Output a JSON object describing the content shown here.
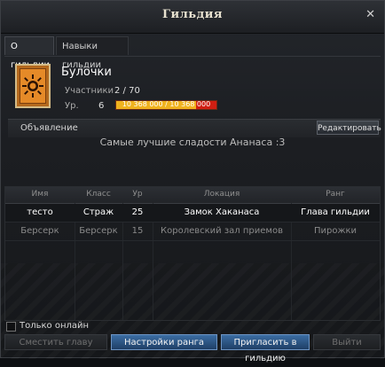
{
  "window": {
    "title": "Гильдия",
    "close_glyph": "✕"
  },
  "tabs": [
    {
      "label": "О гильдии",
      "active": true
    },
    {
      "label": "Навыки гильдии",
      "active": false
    }
  ],
  "guild": {
    "emblem_icon": "sun-emblem-icon",
    "name": "Булочки",
    "members_label": "Участники",
    "members_value": "2 / 70",
    "level_label": "Ур.",
    "level_value": "6",
    "xp_text": "10 368 000 / 10 368 000",
    "xp_fraction": 0.8,
    "colors": {
      "xp_fill": "#f0b21e",
      "xp_bg": "#cf1f12",
      "emblem": "#e58a28"
    }
  },
  "announcement": {
    "label": "Объявление",
    "edit_button": "Редактировать",
    "text": "Самые лучшие сладости Ананаса :3"
  },
  "table": {
    "headers": [
      "Имя",
      "Класс",
      "Ур",
      "Локация",
      "Ранг"
    ],
    "rows": [
      {
        "name": "тесто",
        "class": "Страж",
        "level": "25",
        "location": "Замок Хаканаса",
        "rank": "Глава гильдии",
        "online": true
      },
      {
        "name": "Берсерк",
        "class": "Берсерк",
        "level": "15",
        "location": "Королевский зал приемов",
        "rank": "Пирожки",
        "online": false
      }
    ]
  },
  "footer": {
    "only_online_label": "Только онлайн",
    "buttons": {
      "change_head": "Сместить главу",
      "rank_settings": "Настройки ранга",
      "invite": "Пригласить в гильдию",
      "leave": "Выйти"
    }
  }
}
